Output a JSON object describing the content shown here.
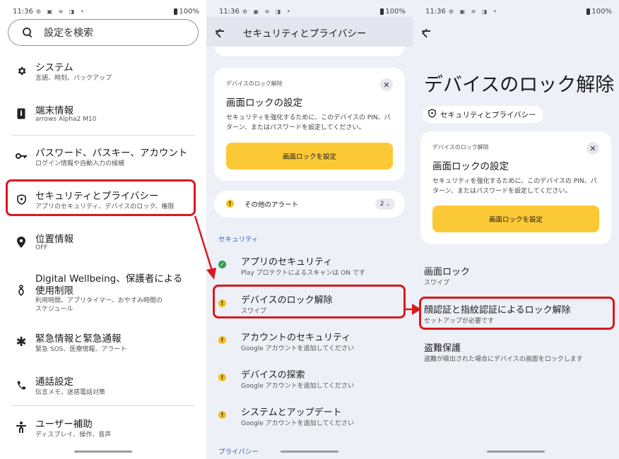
{
  "status": {
    "time": "11:36",
    "battery": "100%"
  },
  "screen1": {
    "search_placeholder": "設定を検索",
    "items": [
      {
        "title": "システム",
        "subtitle": "言語、時刻、バックアップ"
      },
      {
        "title": "端末情報",
        "subtitle": "arrows Alpha2 M10"
      },
      {
        "title": "パスワード、パスキー、アカウント",
        "subtitle": "ログイン情報や自動入力の候補"
      },
      {
        "title": "セキュリティとプライバシー",
        "subtitle": "アプリのセキュリティ、デバイスのロック、権限"
      },
      {
        "title": "位置情報",
        "subtitle": "OFF"
      },
      {
        "title_line1": "Digital Wellbeing、保護者による",
        "title_line2": "使用制限",
        "subtitle_line1": "利用時間、アプリタイマー、おやすみ時間の",
        "subtitle_line2": "スケジュール"
      },
      {
        "title": "緊急情報と緊急通報",
        "subtitle": "緊急 SOS、医療情報、アラート"
      },
      {
        "title": "通話設定",
        "subtitle": "伝言メモ、迷惑電話対策"
      },
      {
        "title": "ユーザー補助",
        "subtitle": "ディスプレイ、操作、音声"
      }
    ]
  },
  "screen2": {
    "title": "セキュリティとプライバシー",
    "card": {
      "caption": "デバイスのロック解除",
      "title": "画面ロックの設定",
      "description": "セキュリティを強化するために、このデバイスの PIN、パターン、またはパスワードを設定してください。",
      "button": "画面ロックを設定"
    },
    "alerts": {
      "label": "その他のアラート",
      "count": "2"
    },
    "section_security": "セキュリティ",
    "items": [
      {
        "title": "アプリのセキュリティ",
        "subtitle": "Play プロテクトによるスキャンは ON です"
      },
      {
        "title": "デバイスのロック解除",
        "subtitle": "スワイプ"
      },
      {
        "title": "アカウントのセキュリティ",
        "subtitle": "Google アカウントを追加してください"
      },
      {
        "title": "デバイスの探索",
        "subtitle": "Google アカウントを追加してください"
      },
      {
        "title": "システムとアップデート",
        "subtitle": "Google アカウントを追加してください"
      }
    ],
    "section_privacy": "プライバシー"
  },
  "screen3": {
    "title": "デバイスのロック解除",
    "chip": "セキュリティとプライバシー",
    "card": {
      "caption": "デバイスのロック解除",
      "title": "画面ロックの設定",
      "description": "セキュリティを強化するために、このデバイスの PIN、パターン、またはパスワードを設定してください。",
      "button": "画面ロックを設定"
    },
    "items": [
      {
        "title": "画面ロック",
        "subtitle": "スワイプ"
      },
      {
        "title": "顔認証と指紋認証によるロック解除",
        "subtitle": "セットアップが必要です"
      },
      {
        "title": "盗難保護",
        "subtitle": "盗難が検出された場合にデバイスの画面をロックします"
      }
    ]
  },
  "colors": {
    "highlight": "#d81920",
    "accent_button": "#fcc936",
    "section_label": "#3a63b8",
    "alert": "#f3c01b",
    "ok": "#2e9e55"
  }
}
